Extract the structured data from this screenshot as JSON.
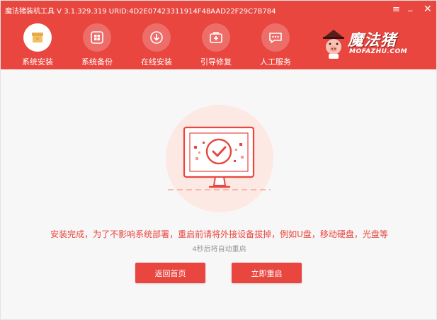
{
  "window": {
    "title": "魔法猪装机工具 V 3.1.329.319 URID:4D2E07423311914F48AAD22F29C7B784",
    "controls": [
      "menu",
      "minimize",
      "close"
    ],
    "menu_glyph": "≡",
    "minimize_glyph": "_",
    "close_glyph": "✕"
  },
  "nav": {
    "items": [
      {
        "label": "系统安装",
        "icon": "install-icon",
        "active": true
      },
      {
        "label": "系统备份",
        "icon": "backup-icon",
        "active": false
      },
      {
        "label": "在线安装",
        "icon": "download-icon",
        "active": false
      },
      {
        "label": "引导修复",
        "icon": "repair-icon",
        "active": false
      },
      {
        "label": "人工服务",
        "icon": "chat-icon",
        "active": false
      }
    ]
  },
  "logo": {
    "name": "魔法猪",
    "sub": "MOFAZHU.COM"
  },
  "main": {
    "illustration": "monitor-check-icon",
    "complete_message": "安装完成，为了不影响系统部署，重启前请将外接设备拔掉，例如U盘，移动硬盘，光盘等",
    "countdown": "4秒后将自动重启",
    "back_home_label": "返回首页",
    "restart_label": "立即重启"
  },
  "colors": {
    "accent": "#e8463f",
    "illustration_bg": "#fde9e4",
    "background": "#f7f7f7"
  }
}
